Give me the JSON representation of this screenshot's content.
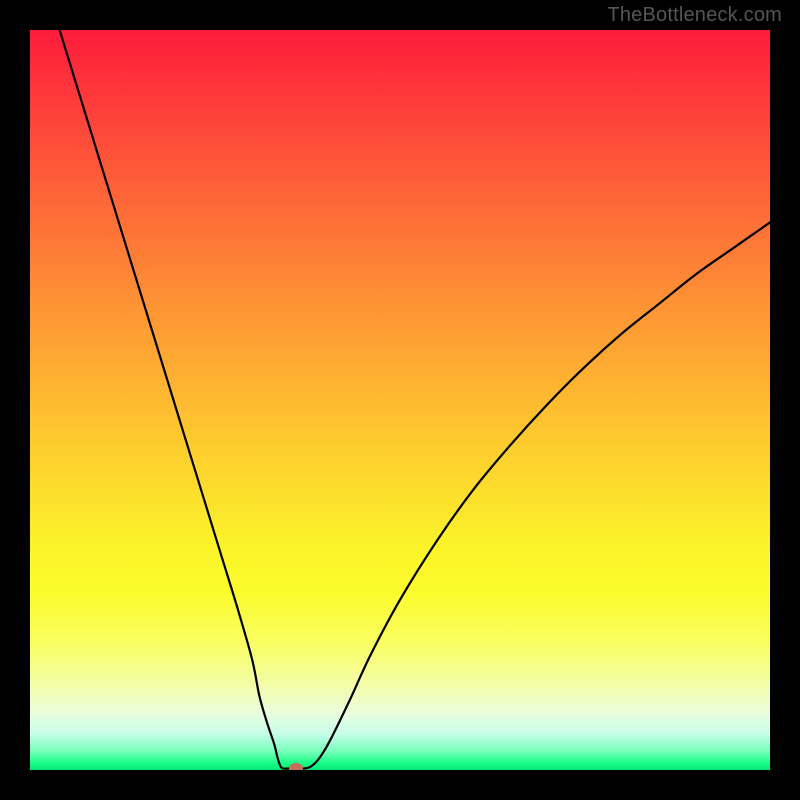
{
  "watermark": "TheBottleneck.com",
  "chart_data": {
    "type": "line",
    "title": "",
    "xlabel": "",
    "ylabel": "",
    "xlim": [
      0,
      100
    ],
    "ylim": [
      0,
      100
    ],
    "grid": false,
    "gradient_stops": [
      {
        "pos": 0,
        "color": "#fd1c3b"
      },
      {
        "pos": 12,
        "color": "#fe433a"
      },
      {
        "pos": 24,
        "color": "#fe6a38"
      },
      {
        "pos": 36,
        "color": "#fe8f35"
      },
      {
        "pos": 48,
        "color": "#feb431"
      },
      {
        "pos": 60,
        "color": "#fdd72d"
      },
      {
        "pos": 70,
        "color": "#fbf42a"
      },
      {
        "pos": 76,
        "color": "#fbfc2b"
      },
      {
        "pos": 83,
        "color": "#f9fe63"
      },
      {
        "pos": 88,
        "color": "#f3fea2"
      },
      {
        "pos": 92,
        "color": "#ecfed8"
      },
      {
        "pos": 95,
        "color": "#c9feec"
      },
      {
        "pos": 97.5,
        "color": "#77feb9"
      },
      {
        "pos": 99,
        "color": "#1afe89"
      },
      {
        "pos": 100,
        "color": "#07e675"
      }
    ],
    "series": [
      {
        "name": "bottleneck-curve",
        "x": [
          4,
          6,
          8,
          10,
          12,
          14,
          16,
          18,
          20,
          22,
          24,
          26,
          28,
          30,
          31,
          32,
          33,
          33.5,
          34,
          35,
          36,
          38,
          40,
          43,
          46,
          50,
          55,
          60,
          65,
          70,
          75,
          80,
          85,
          90,
          95,
          100
        ],
        "y": [
          100,
          93.5,
          87,
          80.5,
          74,
          67.5,
          61,
          54.5,
          48,
          41.5,
          35,
          28.5,
          22,
          15,
          10,
          6.5,
          3.5,
          1.5,
          0.3,
          0.2,
          0.2,
          0.5,
          3,
          9,
          15.5,
          23,
          31,
          38,
          44,
          49.5,
          54.5,
          59,
          63,
          67,
          70.5,
          74
        ]
      }
    ],
    "trough": {
      "x": 35,
      "y": 0.2
    },
    "marker": {
      "x": 36,
      "y": 0.3,
      "color": "#c66e5e"
    }
  }
}
